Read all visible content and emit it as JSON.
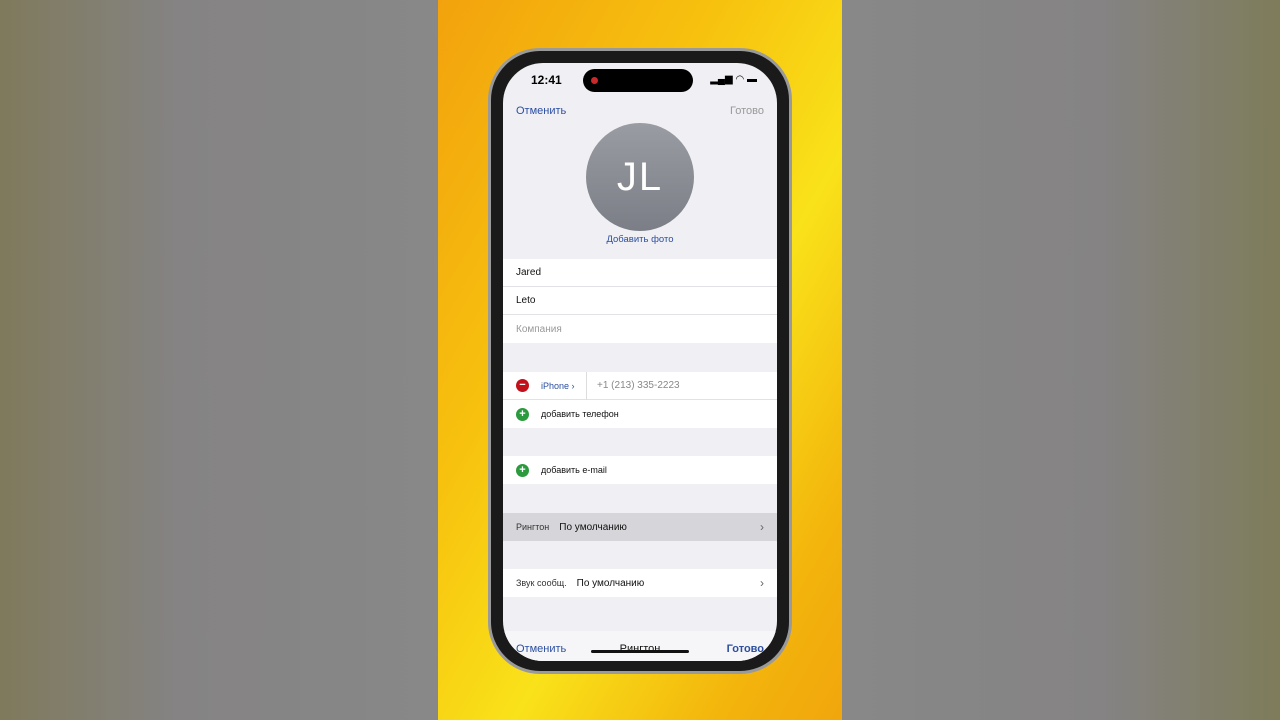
{
  "status_bar": {
    "time": "12:41"
  },
  "nav": {
    "cancel": "Отменить",
    "done": "Готово"
  },
  "avatar": {
    "initials": "JL",
    "add_photo": "Добавить фото"
  },
  "fields": {
    "first_name": "Jared",
    "last_name": "Leto",
    "company_placeholder": "Компания"
  },
  "phone": {
    "label": "iPhone",
    "number": "+1 (213) 335-2223",
    "add_phone": "добавить телефон"
  },
  "email": {
    "add_email": "добавить e-mail"
  },
  "ringtone": {
    "label": "Рингтон",
    "value": "По умолчанию"
  },
  "text_tone": {
    "label": "Звук сообщ.",
    "value": "По умолчанию"
  },
  "bottom_bar": {
    "cancel": "Отменить",
    "title": "Рингтон",
    "done": "Готово"
  },
  "colors": {
    "accent": "#2c4fa0",
    "delete": "#c3111c",
    "add": "#2b9a3e"
  }
}
